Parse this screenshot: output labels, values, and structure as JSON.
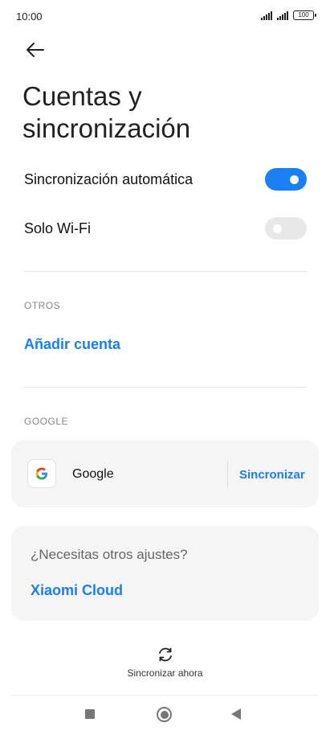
{
  "status_bar": {
    "time": "10:00",
    "battery": "100"
  },
  "header": {
    "title": "Cuentas y sincronización"
  },
  "settings": {
    "auto_sync": {
      "label": "Sincronización automática",
      "enabled": true
    },
    "wifi_only": {
      "label": "Solo Wi-Fi",
      "enabled": false
    }
  },
  "others": {
    "section_label": "OTROS",
    "add_account_label": "Añadir cuenta"
  },
  "google": {
    "section_label": "GOOGLE",
    "account_name": "Google",
    "sync_label": "Sincronizar"
  },
  "cloud_card": {
    "question": "¿Necesitas otros ajustes?",
    "link_label": "Xiaomi Cloud"
  },
  "footer": {
    "sync_now_label": "Sincronizar ahora"
  },
  "colors": {
    "accent": "#1a7ff2",
    "toggle_off": "#e8e8e8",
    "card_bg": "#f5f5f5"
  }
}
